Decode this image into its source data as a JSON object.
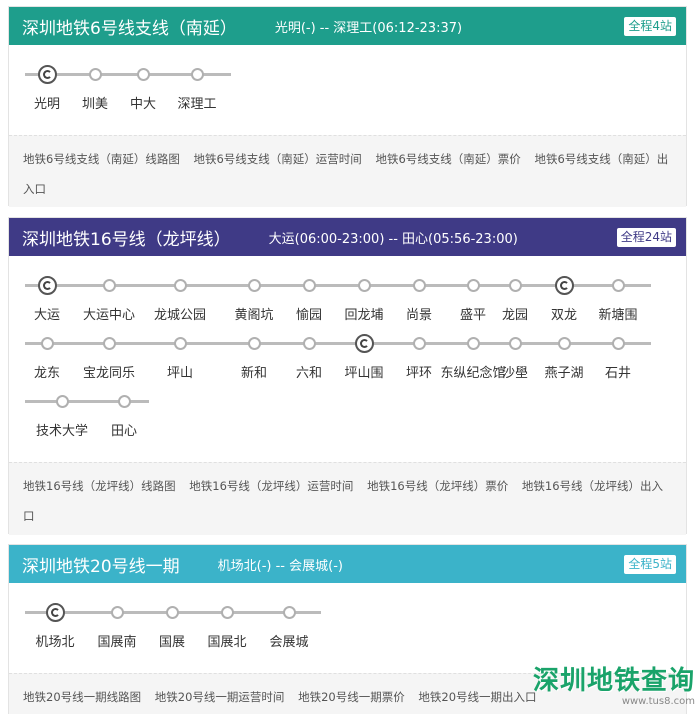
{
  "lines": [
    {
      "name": "深圳地铁6号线支线（南延）",
      "hours": "光明(-) -- 深理工(06:12-23:37)",
      "count": "全程4站",
      "color": "#1e9e8c",
      "stations": [
        "光明",
        "圳美",
        "中大",
        "深理工"
      ],
      "transfer": [
        "光明"
      ],
      "links": [
        "地铁6号线支线（南延）线路图",
        "地铁6号线支线（南延）运营时间",
        "地铁6号线支线（南延）票价",
        "地铁6号线支线（南延）出入口"
      ]
    },
    {
      "name": "深圳地铁16号线（龙坪线）",
      "hours": "大运(06:00-23:00) -- 田心(05:56-23:00)",
      "count": "全程24站",
      "color": "#3f3a86",
      "stations": [
        "大运",
        "大运中心",
        "龙城公园",
        "黄阁坑",
        "愉园",
        "回龙埔",
        "尚景",
        "盛平",
        "龙园",
        "双龙",
        "新塘围",
        "龙东",
        "宝龙同乐",
        "坪山",
        "新和",
        "六和",
        "坪山围",
        "坪环",
        "东纵纪念馆",
        "沙壆",
        "燕子湖",
        "石井",
        "技术大学",
        "田心"
      ],
      "transfer": [
        "大运",
        "双龙",
        "坪山围"
      ],
      "links": [
        "地铁16号线（龙坪线）线路图",
        "地铁16号线（龙坪线）运营时间",
        "地铁16号线（龙坪线）票价",
        "地铁16号线（龙坪线）出入口"
      ]
    },
    {
      "name": "深圳地铁20号线一期",
      "hours": "机场北(-) -- 会展城(-)",
      "count": "全程5站",
      "color": "#3bb3c9",
      "stations": [
        "机场北",
        "国展南",
        "国展",
        "国展北",
        "会展城"
      ],
      "transfer": [
        "机场北"
      ],
      "links": [
        "地铁20号线一期线路图",
        "地铁20号线一期运营时间",
        "地铁20号线一期票价",
        "地铁20号线一期出入口"
      ]
    }
  ],
  "watermark": {
    "title": "深圳地铁查询",
    "site": "www.tus8.com"
  }
}
